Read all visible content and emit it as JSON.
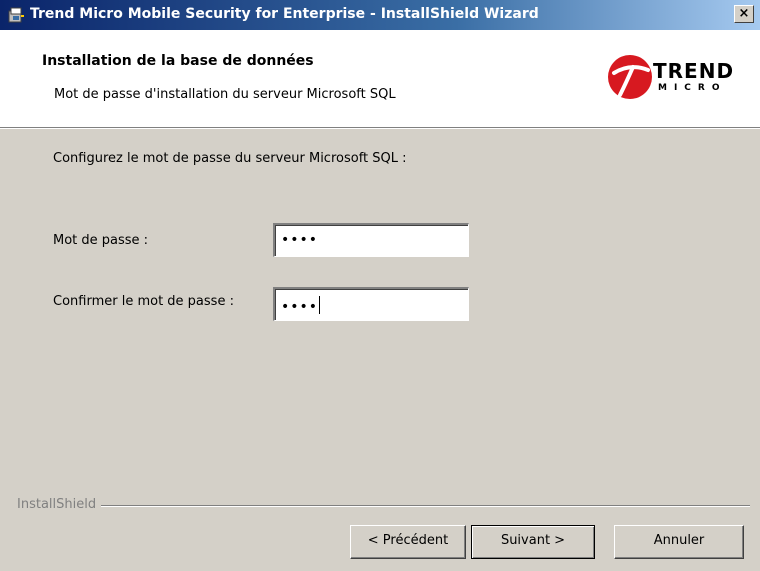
{
  "window": {
    "title": "Trend Micro Mobile Security for Enterprise - InstallShield Wizard",
    "close_label": "×"
  },
  "header": {
    "heading": "Installation de la base de données",
    "subheading": "Mot de passe d'installation du serveur Microsoft SQL",
    "logo_line1": "TREND",
    "logo_line2": "MICRO"
  },
  "main": {
    "intro": "Configurez le mot de passe du serveur Microsoft SQL :",
    "password_label": "Mot de passe :",
    "password_value": "••••",
    "confirm_label": "Confirmer le mot de passe :",
    "confirm_value": "••••"
  },
  "footer": {
    "brand": "InstallShield",
    "back_label": "< Précédent",
    "next_label": "Suivant >",
    "cancel_label": "Annuler"
  },
  "colors": {
    "titlebar_start": "#0a246a",
    "titlebar_end": "#a6caf0",
    "dialog_bg": "#d4d0c8",
    "logo_red": "#d71920"
  },
  "icons": {
    "app": "installer-icon",
    "logo": "trend-micro-ball-icon"
  }
}
